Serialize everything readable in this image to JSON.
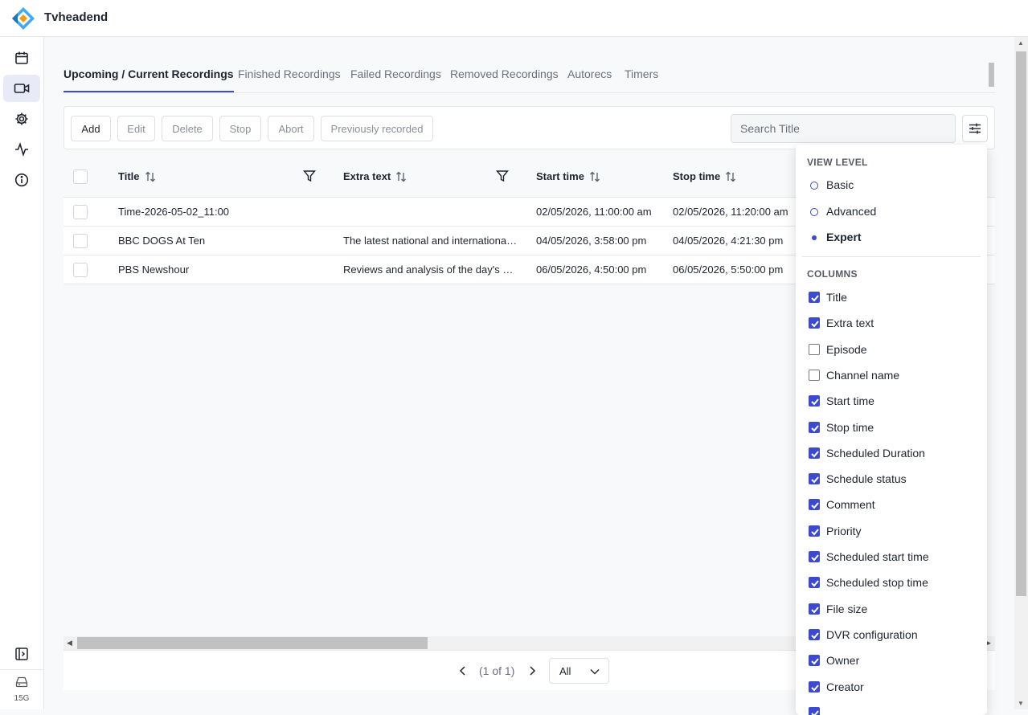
{
  "app": {
    "title": "Tvheadend"
  },
  "sidebar": {
    "storage_label": "15G"
  },
  "tabs": [
    {
      "label": "Upcoming / Current Recordings"
    },
    {
      "label": "Finished Recordings"
    },
    {
      "label": "Failed Recordings"
    },
    {
      "label": "Removed Recordings"
    },
    {
      "label": "Autorecs"
    },
    {
      "label": "Timers"
    }
  ],
  "toolbar": {
    "add": "Add",
    "edit": "Edit",
    "delete": "Delete",
    "stop": "Stop",
    "abort": "Abort",
    "previously_recorded": "Previously recorded",
    "search_placeholder": "Search Title"
  },
  "table": {
    "columns": {
      "title": "Title",
      "extra_text": "Extra text",
      "start_time": "Start time",
      "stop_time": "Stop time"
    },
    "rows": [
      {
        "title": "Time-2026-05-02_11:00",
        "extra_text": "",
        "start_time": "02/05/2026, 11:00:00 am",
        "stop_time": "02/05/2026, 11:20:00 am"
      },
      {
        "title": "BBC DOGS At Ten",
        "extra_text": "The latest national and international news",
        "start_time": "04/05/2026, 3:58:00 pm",
        "stop_time": "04/05/2026, 4:21:30 pm"
      },
      {
        "title": "PBS Newshour",
        "extra_text": "Reviews and analysis of the day's news",
        "start_time": "06/05/2026, 4:50:00 pm",
        "stop_time": "06/05/2026, 5:50:00 pm"
      }
    ]
  },
  "pager": {
    "label": "(1 of 1)",
    "page_size": "All"
  },
  "panel": {
    "view_level_heading": "VIEW LEVEL",
    "view_levels": [
      {
        "label": "Basic",
        "selected": false
      },
      {
        "label": "Advanced",
        "selected": false
      },
      {
        "label": "Expert",
        "selected": true
      }
    ],
    "columns_heading": "COLUMNS",
    "columns": [
      {
        "label": "Title",
        "checked": true
      },
      {
        "label": "Extra text",
        "checked": true
      },
      {
        "label": "Episode",
        "checked": false
      },
      {
        "label": "Channel name",
        "checked": false
      },
      {
        "label": "Start time",
        "checked": true
      },
      {
        "label": "Stop time",
        "checked": true
      },
      {
        "label": "Scheduled Duration",
        "checked": true
      },
      {
        "label": "Schedule status",
        "checked": true
      },
      {
        "label": "Comment",
        "checked": true
      },
      {
        "label": "Priority",
        "checked": true
      },
      {
        "label": "Scheduled start time",
        "checked": true
      },
      {
        "label": "Scheduled stop time",
        "checked": true
      },
      {
        "label": "File size",
        "checked": true
      },
      {
        "label": "DVR configuration",
        "checked": true
      },
      {
        "label": "Owner",
        "checked": true
      },
      {
        "label": "Creator",
        "checked": true
      },
      {
        "label": "",
        "checked": true
      }
    ]
  },
  "colors": {
    "accent": "#3b4ad0",
    "border": "#e4e6ea",
    "background": "#f8f9fb"
  }
}
